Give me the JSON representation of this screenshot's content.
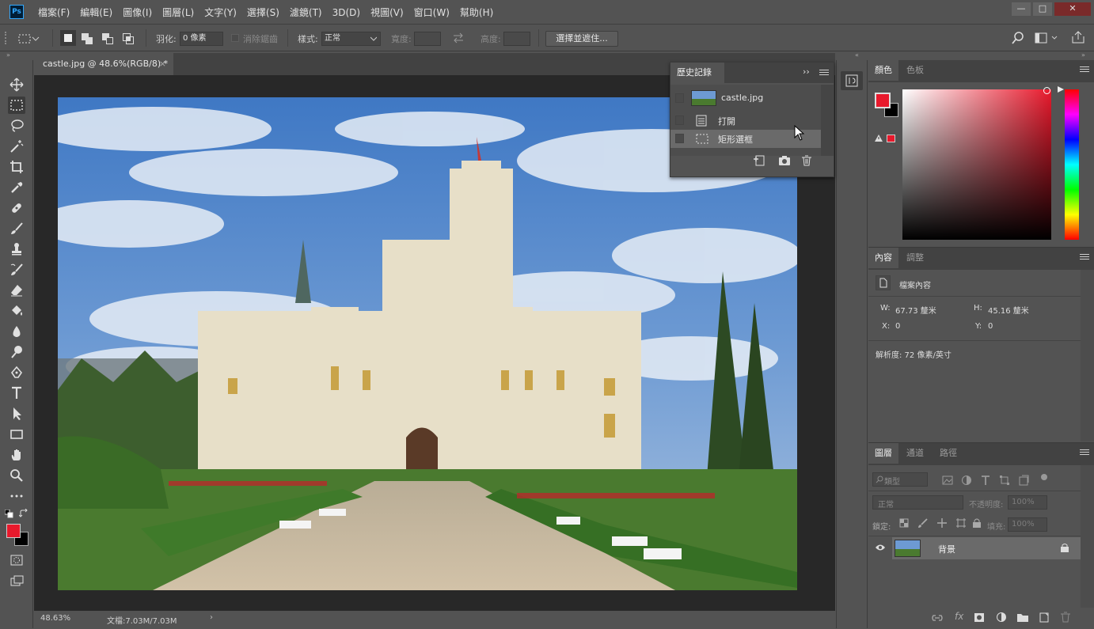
{
  "app": {
    "logo": "Ps"
  },
  "menu": [
    "檔案(F)",
    "編輯(E)",
    "圖像(I)",
    "圖層(L)",
    "文字(Y)",
    "選擇(S)",
    "濾鏡(T)",
    "3D(D)",
    "視圖(V)",
    "窗口(W)",
    "幫助(H)"
  ],
  "window_controls": {
    "minimize": "—",
    "maximize": "□",
    "close": "✕"
  },
  "options": {
    "feather_label": "羽化:",
    "feather_value": "0 像素",
    "antialias_label": "消除鋸齒",
    "style_label": "樣式:",
    "style_value": "正常",
    "width_label": "寬度:",
    "height_label": "高度:",
    "select_mask_button": "選擇並遮住..."
  },
  "document": {
    "tab_title": "castle.jpg @ 48.6%(RGB/8) *",
    "zoom": "48.63%",
    "doc_size": "文檔:7.03M/7.03M"
  },
  "history": {
    "tab": "歷史記錄",
    "snapshot_name": "castle.jpg",
    "states": [
      "打開",
      "矩形選框"
    ]
  },
  "color_panel": {
    "tabs": [
      "顏色",
      "色板"
    ],
    "foreground": "#e8192c",
    "background": "#000000"
  },
  "properties_panel": {
    "tabs": [
      "內容",
      "調整"
    ],
    "doc_label": "檔案內容",
    "w_label": "W:",
    "w_value": "67.73 釐米",
    "h_label": "H:",
    "h_value": "45.16 釐米",
    "x_label": "X:",
    "x_value": "0",
    "y_label": "Y:",
    "y_value": "0",
    "resolution": "解析度: 72 像素/英寸"
  },
  "layers_panel": {
    "tabs": [
      "圖層",
      "通道",
      "路徑"
    ],
    "filter_placeholder": "類型",
    "blend_mode": "正常",
    "opacity_label": "不透明度:",
    "opacity_value": "100%",
    "lock_label": "鎖定:",
    "fill_label": "填充:",
    "fill_value": "100%",
    "layer_name": "背景"
  }
}
